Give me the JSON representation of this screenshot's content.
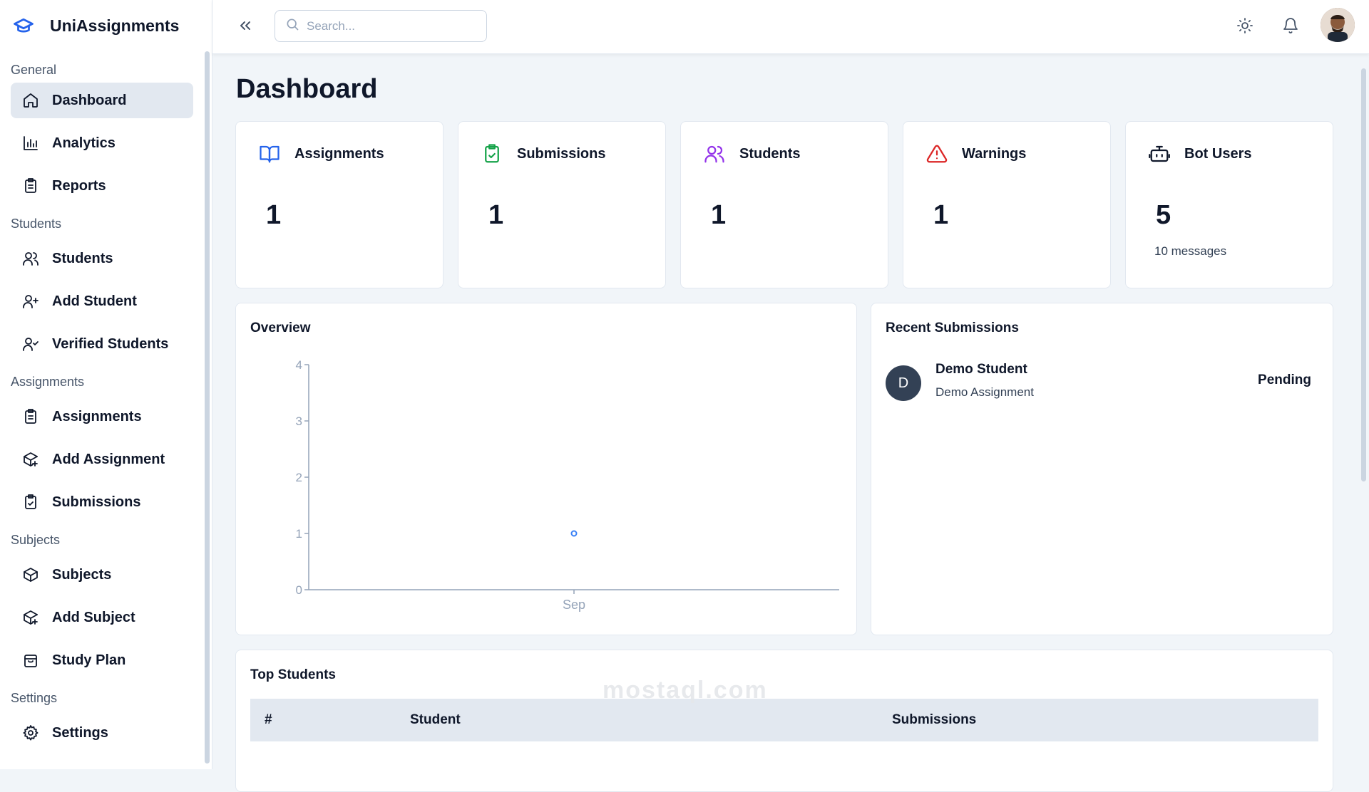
{
  "brand": {
    "title": "UniAssignments",
    "icon": "graduation-cap-icon"
  },
  "sidebar": {
    "groups": [
      {
        "label": "General",
        "items": [
          {
            "label": "Dashboard",
            "icon": "home-icon",
            "active": true
          },
          {
            "label": "Analytics",
            "icon": "bar-chart-icon"
          },
          {
            "label": "Reports",
            "icon": "clipboard-list-icon"
          }
        ]
      },
      {
        "label": "Students",
        "items": [
          {
            "label": "Students",
            "icon": "users-icon"
          },
          {
            "label": "Add Student",
            "icon": "user-plus-icon"
          },
          {
            "label": "Verified Students",
            "icon": "user-check-icon"
          }
        ]
      },
      {
        "label": "Assignments",
        "items": [
          {
            "label": "Assignments",
            "icon": "clipboard-list-icon"
          },
          {
            "label": "Add Assignment",
            "icon": "package-plus-icon"
          },
          {
            "label": "Submissions",
            "icon": "clipboard-check-icon"
          }
        ]
      },
      {
        "label": "Subjects",
        "items": [
          {
            "label": "Subjects",
            "icon": "box-icon"
          },
          {
            "label": "Add Subject",
            "icon": "package-plus-icon"
          },
          {
            "label": "Study Plan",
            "icon": "calendar-box-icon"
          }
        ]
      },
      {
        "label": "Settings",
        "items": [
          {
            "label": "Settings",
            "icon": "gear-icon"
          }
        ]
      }
    ]
  },
  "header": {
    "search_placeholder": "Search..."
  },
  "page": {
    "title": "Dashboard"
  },
  "stats": [
    {
      "label": "Assignments",
      "value": "1",
      "sub": "",
      "icon": "book-open-icon",
      "color": "#2563eb"
    },
    {
      "label": "Submissions",
      "value": "1",
      "sub": "",
      "icon": "clipboard-check-icon",
      "color": "#16a34a"
    },
    {
      "label": "Students",
      "value": "1",
      "sub": "",
      "icon": "users-icon",
      "color": "#9333ea"
    },
    {
      "label": "Warnings",
      "value": "1",
      "sub": "",
      "icon": "alert-triangle-icon",
      "color": "#dc2626"
    },
    {
      "label": "Bot Users",
      "value": "5",
      "sub": "10 messages",
      "icon": "bot-icon",
      "color": "#0f172a"
    }
  ],
  "overview": {
    "title": "Overview",
    "chart_data": {
      "type": "line",
      "categories": [
        "Sep"
      ],
      "series": [
        {
          "values": [
            1
          ]
        }
      ],
      "ylim": [
        0,
        4
      ],
      "yticks": [
        0,
        1,
        2,
        3,
        4
      ],
      "title": "",
      "xlabel": "",
      "ylabel": "",
      "grid": false
    }
  },
  "recent": {
    "title": "Recent Submissions",
    "items": [
      {
        "initial": "D",
        "name": "Demo Student",
        "assignment": "Demo Assignment",
        "status": "Pending"
      }
    ]
  },
  "top_students": {
    "title": "Top Students",
    "columns": [
      "#",
      "Student",
      "Submissions"
    ]
  },
  "watermark": "mostaql.com"
}
